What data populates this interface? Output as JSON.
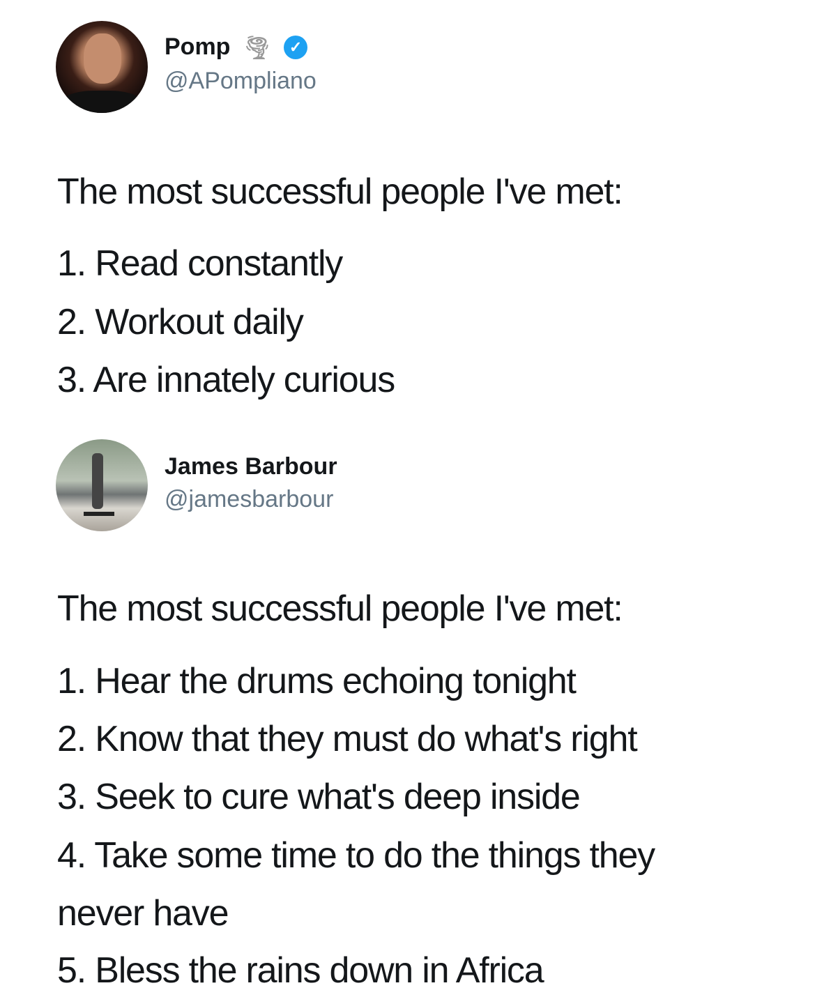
{
  "tweets": [
    {
      "name": "Pomp",
      "name_emoji": "🌪",
      "verified_icon": "verified-badge-icon",
      "handle": "@APompliano",
      "lines": [
        "The most successful people I've met:",
        "1. Read constantly",
        "2. Workout daily",
        "3. Are innately curious"
      ]
    },
    {
      "name": "James Barbour",
      "handle": "@jamesbarbour",
      "lines": [
        "The most successful people I've met:",
        "1. Hear the drums echoing tonight",
        "2. Know that they must do what's right",
        "3. Seek to cure what's deep inside",
        "4. Take some time to do the things they",
        "never have",
        "5. Bless the rains down in Africa"
      ]
    }
  ],
  "colors": {
    "verified": "#1da1f2",
    "handle": "#657786",
    "text": "#14171a"
  }
}
